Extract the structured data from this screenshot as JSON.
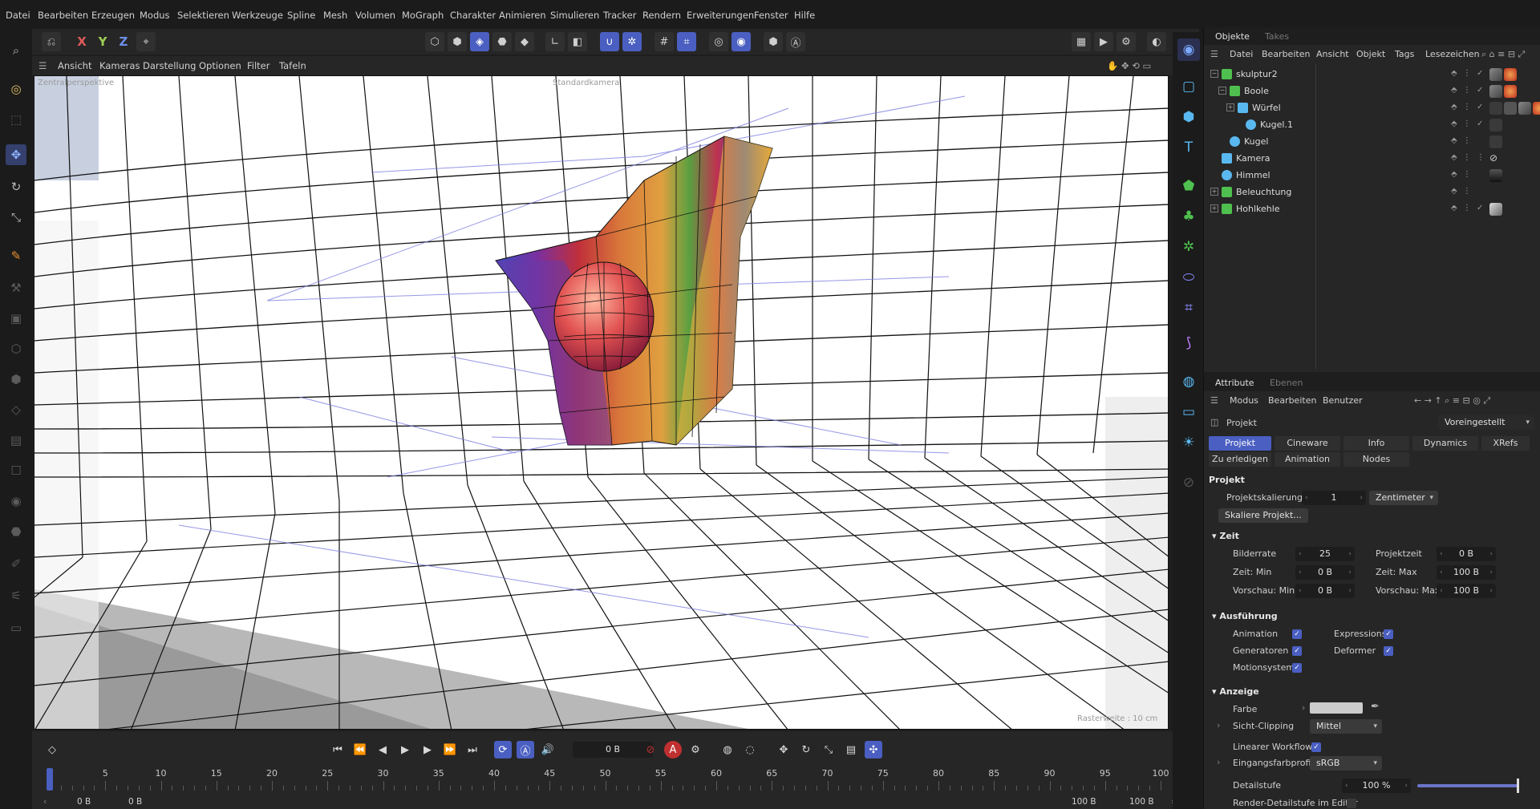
{
  "menu": [
    "Datei",
    "Bearbeiten",
    "Erzeugen",
    "Modus",
    "Selektieren",
    "Werkzeuge",
    "Spline",
    "Mesh",
    "Volumen",
    "MoGraph",
    "Charakter",
    "Animieren",
    "Simulieren",
    "Tracker",
    "Rendern",
    "Erweiterungen",
    "Fenster",
    "Hilfe"
  ],
  "toolbar": {
    "x": "X",
    "y": "Y",
    "z": "Z"
  },
  "viewport": {
    "menu": [
      "Ansicht",
      "Kameras",
      "Darstellung",
      "Optionen",
      "Filter",
      "Tafeln"
    ],
    "camera_label": "Zentralperspektive",
    "default_camera": "Standardkamera",
    "grid_label": "Rasterweite : 10 cm"
  },
  "timeline": {
    "current_frame": "0 B",
    "ruler": [
      "0",
      "5",
      "10",
      "15",
      "20",
      "25",
      "30",
      "35",
      "40",
      "45",
      "50",
      "55",
      "60",
      "65",
      "70",
      "75",
      "80",
      "85",
      "90",
      "95",
      "100"
    ],
    "range_start": "0 B",
    "range_start2": "0 B",
    "range_end": "100 B",
    "range_end2": "100 B"
  },
  "objects_panel": {
    "tabs": [
      "Objekte",
      "Takes"
    ],
    "menu": [
      "Datei",
      "Bearbeiten",
      "Ansicht",
      "Objekt",
      "Tags",
      "Lesezeichen"
    ],
    "items": [
      {
        "name": "skulptur2",
        "depth": 0,
        "icon_color": "#4fc04f"
      },
      {
        "name": "Boole",
        "depth": 1,
        "icon_color": "#4fc04f"
      },
      {
        "name": "Würfel",
        "depth": 2,
        "icon_color": "#5ab8f0"
      },
      {
        "name": "Kugel.1",
        "depth": 3,
        "icon_color": "#5ab8f0"
      },
      {
        "name": "Kugel",
        "depth": 1,
        "icon_color": "#5ab8f0"
      },
      {
        "name": "Kamera",
        "depth": 0,
        "icon_color": "#5ab8f0"
      },
      {
        "name": "Himmel",
        "depth": 0,
        "icon_color": "#5ab8f0"
      },
      {
        "name": "Beleuchtung",
        "depth": 0,
        "icon_color": "#4fc04f"
      },
      {
        "name": "Hohlkehle",
        "depth": 0,
        "icon_color": "#4fc04f"
      }
    ]
  },
  "attributes_panel": {
    "tabs": [
      "Attribute",
      "Ebenen"
    ],
    "menu": [
      "Modus",
      "Bearbeiten",
      "Benutzer"
    ],
    "title": "Projekt",
    "preset": "Voreingestellt",
    "ptabs": [
      "Projekt",
      "Cineware",
      "Info",
      "Dynamics",
      "XRefs",
      "Zu erledigen",
      "Animation",
      "Nodes"
    ],
    "section_title": "Projekt",
    "scale_label": "Projektskalierung",
    "scale_value": "1",
    "scale_unit": "Zentimeter",
    "scale_button": "Skaliere Projekt...",
    "zeit": "Zeit",
    "bilderrate_label": "Bilderrate",
    "bilderrate": "25",
    "projektzeit_label": "Projektzeit",
    "projektzeit": "0 B",
    "zeitmin_label": "Zeit: Min",
    "zeitmin": "0 B",
    "zeitmax_label": "Zeit: Max",
    "zeitmax": "100 B",
    "vorschaumin_label": "Vorschau: Min",
    "vorschaumin": "0 B",
    "vorschaumax_label": "Vorschau: Max",
    "vorschaumax": "100 B",
    "ausfuehrung": "Ausführung",
    "animation": "Animation",
    "expressions": "Expressions",
    "generatoren": "Generatoren",
    "deformer": "Deformer",
    "motionsystem": "Motionsystem",
    "anzeige": "Anzeige",
    "farbe": "Farbe",
    "sicht_clipping": "Sicht-Clipping",
    "sicht_clipping_value": "Mittel",
    "linearer_workflow": "Linearer Workflow",
    "eingangsfarbprofil": "Eingangsfarbprofil",
    "eingangsfarbprofil_value": "sRGB",
    "detailstufe": "Detailstufe",
    "detailstufe_value": "100 %",
    "render_detail": "Render-Detailstufe im Editor"
  },
  "colors": {
    "accent": "#4a5fc1",
    "panel": "#262626",
    "bg": "#1b1b1b"
  }
}
